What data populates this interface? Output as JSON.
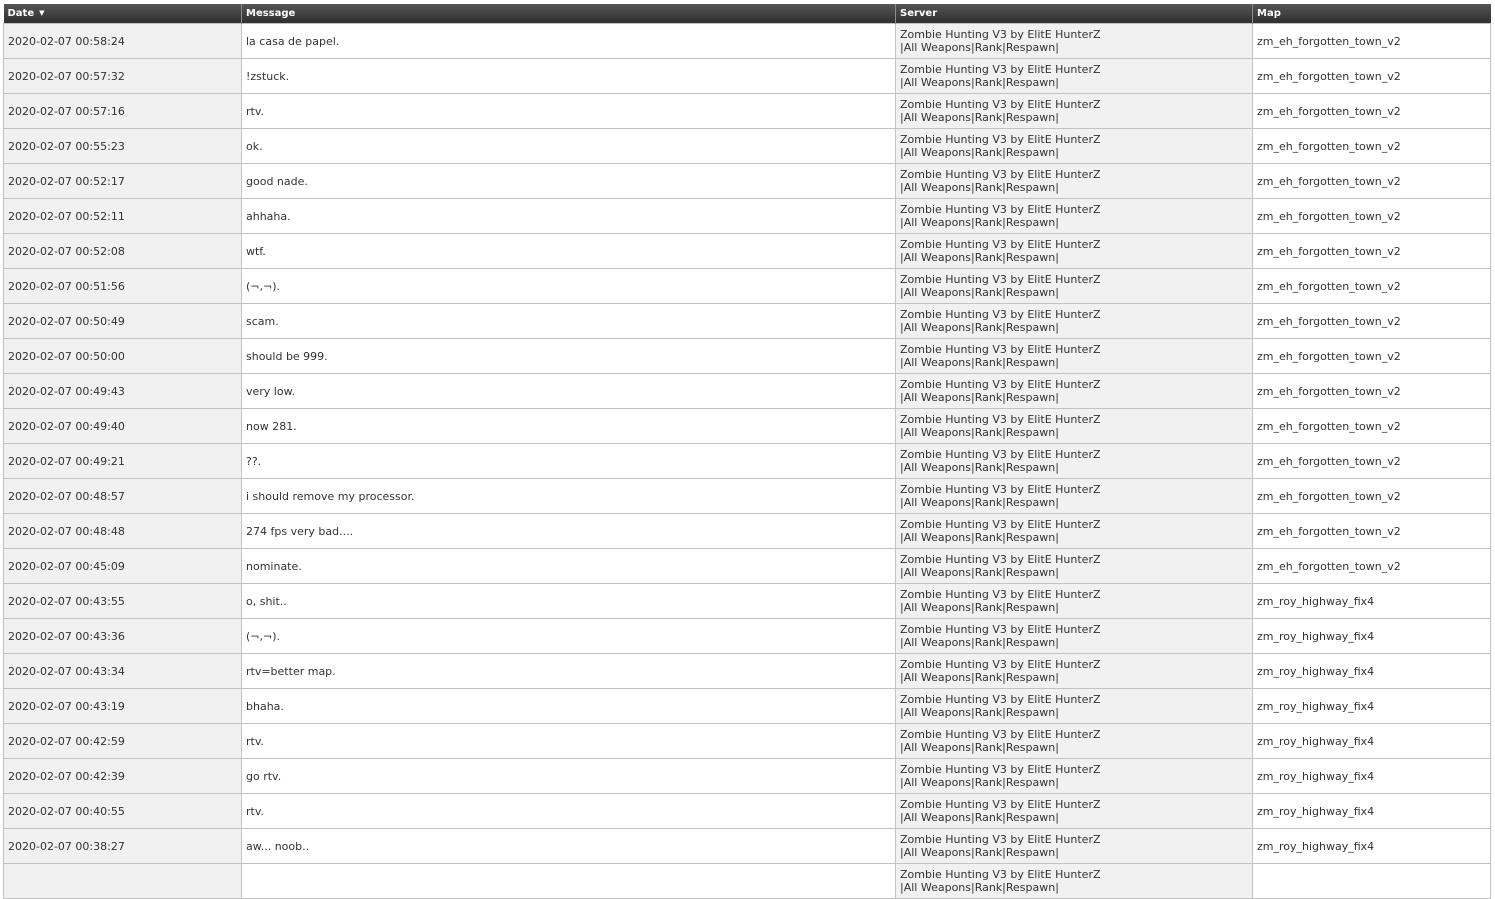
{
  "columns": {
    "date": "Date",
    "message": "Message",
    "server": "Server",
    "map": "Map",
    "sort_icon": "▼"
  },
  "rows": [
    {
      "date": "2020-02-07 00:58:24",
      "message": "la casa de papel.",
      "server": "Zombie Hunting V3 by ElitE HunterZ |All Weapons|Rank|Respawn|",
      "map": "zm_eh_forgotten_town_v2"
    },
    {
      "date": "2020-02-07 00:57:32",
      "message": "!zstuck.",
      "server": "Zombie Hunting V3 by ElitE HunterZ |All Weapons|Rank|Respawn|",
      "map": "zm_eh_forgotten_town_v2"
    },
    {
      "date": "2020-02-07 00:57:16",
      "message": "rtv.",
      "server": "Zombie Hunting V3 by ElitE HunterZ |All Weapons|Rank|Respawn|",
      "map": "zm_eh_forgotten_town_v2"
    },
    {
      "date": "2020-02-07 00:55:23",
      "message": "ok.",
      "server": "Zombie Hunting V3 by ElitE HunterZ |All Weapons|Rank|Respawn|",
      "map": "zm_eh_forgotten_town_v2"
    },
    {
      "date": "2020-02-07 00:52:17",
      "message": "good nade.",
      "server": "Zombie Hunting V3 by ElitE HunterZ |All Weapons|Rank|Respawn|",
      "map": "zm_eh_forgotten_town_v2"
    },
    {
      "date": "2020-02-07 00:52:11",
      "message": "ahhaha.",
      "server": "Zombie Hunting V3 by ElitE HunterZ |All Weapons|Rank|Respawn|",
      "map": "zm_eh_forgotten_town_v2"
    },
    {
      "date": "2020-02-07 00:52:08",
      "message": "wtf.",
      "server": "Zombie Hunting V3 by ElitE HunterZ |All Weapons|Rank|Respawn|",
      "map": "zm_eh_forgotten_town_v2"
    },
    {
      "date": "2020-02-07 00:51:56",
      "message": "(¬,¬).",
      "server": "Zombie Hunting V3 by ElitE HunterZ |All Weapons|Rank|Respawn|",
      "map": "zm_eh_forgotten_town_v2"
    },
    {
      "date": "2020-02-07 00:50:49",
      "message": "scam.",
      "server": "Zombie Hunting V3 by ElitE HunterZ |All Weapons|Rank|Respawn|",
      "map": "zm_eh_forgotten_town_v2"
    },
    {
      "date": "2020-02-07 00:50:00",
      "message": "should be 999.",
      "server": "Zombie Hunting V3 by ElitE HunterZ |All Weapons|Rank|Respawn|",
      "map": "zm_eh_forgotten_town_v2"
    },
    {
      "date": "2020-02-07 00:49:43",
      "message": "very low.",
      "server": "Zombie Hunting V3 by ElitE HunterZ |All Weapons|Rank|Respawn|",
      "map": "zm_eh_forgotten_town_v2"
    },
    {
      "date": "2020-02-07 00:49:40",
      "message": "now 281.",
      "server": "Zombie Hunting V3 by ElitE HunterZ |All Weapons|Rank|Respawn|",
      "map": "zm_eh_forgotten_town_v2"
    },
    {
      "date": "2020-02-07 00:49:21",
      "message": "??.",
      "server": "Zombie Hunting V3 by ElitE HunterZ |All Weapons|Rank|Respawn|",
      "map": "zm_eh_forgotten_town_v2"
    },
    {
      "date": "2020-02-07 00:48:57",
      "message": "i should remove my processor.",
      "server": "Zombie Hunting V3 by ElitE HunterZ |All Weapons|Rank|Respawn|",
      "map": "zm_eh_forgotten_town_v2"
    },
    {
      "date": "2020-02-07 00:48:48",
      "message": "274 fps very bad....",
      "server": "Zombie Hunting V3 by ElitE HunterZ |All Weapons|Rank|Respawn|",
      "map": "zm_eh_forgotten_town_v2"
    },
    {
      "date": "2020-02-07 00:45:09",
      "message": "nominate.",
      "server": "Zombie Hunting V3 by ElitE HunterZ |All Weapons|Rank|Respawn|",
      "map": "zm_eh_forgotten_town_v2"
    },
    {
      "date": "2020-02-07 00:43:55",
      "message": "o, shit..",
      "server": "Zombie Hunting V3 by ElitE HunterZ |All Weapons|Rank|Respawn|",
      "map": "zm_roy_highway_fix4"
    },
    {
      "date": "2020-02-07 00:43:36",
      "message": "(¬,¬).",
      "server": "Zombie Hunting V3 by ElitE HunterZ |All Weapons|Rank|Respawn|",
      "map": "zm_roy_highway_fix4"
    },
    {
      "date": "2020-02-07 00:43:34",
      "message": "rtv=better map.",
      "server": "Zombie Hunting V3 by ElitE HunterZ |All Weapons|Rank|Respawn|",
      "map": "zm_roy_highway_fix4"
    },
    {
      "date": "2020-02-07 00:43:19",
      "message": "bhaha.",
      "server": "Zombie Hunting V3 by ElitE HunterZ |All Weapons|Rank|Respawn|",
      "map": "zm_roy_highway_fix4"
    },
    {
      "date": "2020-02-07 00:42:59",
      "message": "rtv.",
      "server": "Zombie Hunting V3 by ElitE HunterZ |All Weapons|Rank|Respawn|",
      "map": "zm_roy_highway_fix4"
    },
    {
      "date": "2020-02-07 00:42:39",
      "message": "go rtv.",
      "server": "Zombie Hunting V3 by ElitE HunterZ |All Weapons|Rank|Respawn|",
      "map": "zm_roy_highway_fix4"
    },
    {
      "date": "2020-02-07 00:40:55",
      "message": "rtv.",
      "server": "Zombie Hunting V3 by ElitE HunterZ |All Weapons|Rank|Respawn|",
      "map": "zm_roy_highway_fix4"
    },
    {
      "date": "2020-02-07 00:38:27",
      "message": "aw... noob..",
      "server": "Zombie Hunting V3 by ElitE HunterZ |All Weapons|Rank|Respawn|",
      "map": "zm_roy_highway_fix4"
    },
    {
      "date": "",
      "message": "",
      "server": "Zombie Hunting V3 by ElitE HunterZ |All Weapons|Rank|Respawn|",
      "map": ""
    }
  ]
}
